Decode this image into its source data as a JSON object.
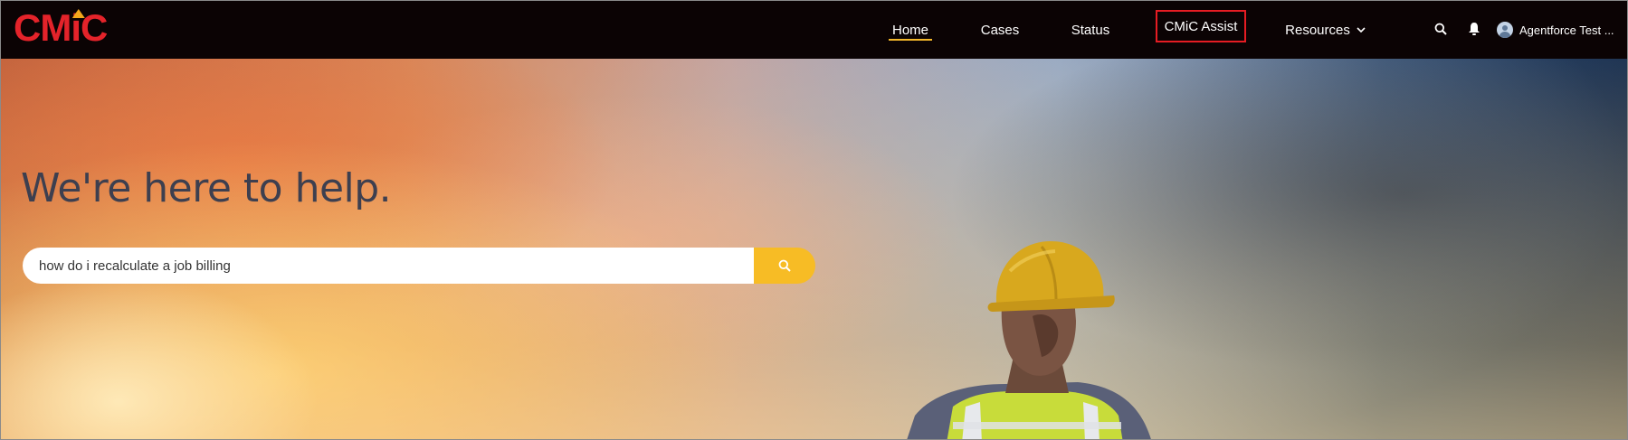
{
  "brand": {
    "logo_text_before": "CM",
    "logo_text_i": "i",
    "logo_text_after": "C",
    "color_red": "#e4232a",
    "color_accent": "#f2a71b"
  },
  "nav": {
    "home": "Home",
    "cases": "Cases",
    "status": "Status",
    "assist": "CMiC Assist",
    "resources": "Resources"
  },
  "header": {
    "search_icon": "search-icon",
    "bell_icon": "bell-icon",
    "user_name": "Agentforce Test ..."
  },
  "hero": {
    "title": "We're here to help.",
    "search_value": "how do i recalculate a job billing",
    "search_button_color": "#f7bc25"
  }
}
